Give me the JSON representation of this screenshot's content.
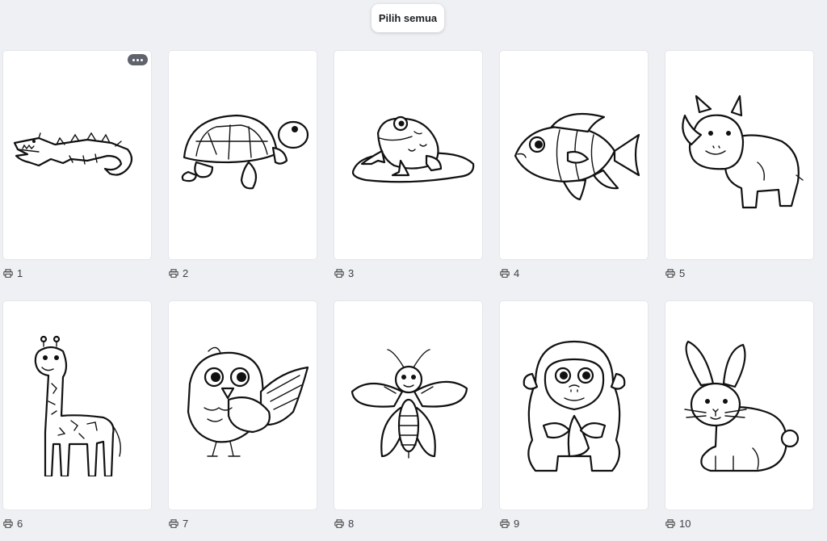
{
  "toolbar": {
    "select_all_label": "Pilih semua"
  },
  "pages": [
    {
      "number": "1",
      "illustration": "crocodile"
    },
    {
      "number": "2",
      "illustration": "turtle"
    },
    {
      "number": "3",
      "illustration": "frog"
    },
    {
      "number": "4",
      "illustration": "fish"
    },
    {
      "number": "5",
      "illustration": "rhino"
    },
    {
      "number": "6",
      "illustration": "giraffe"
    },
    {
      "number": "7",
      "illustration": "bird"
    },
    {
      "number": "8",
      "illustration": "bee"
    },
    {
      "number": "9",
      "illustration": "gorilla"
    },
    {
      "number": "10",
      "illustration": "rabbit"
    }
  ],
  "icons": {
    "page_icon": "printer-icon",
    "menu_icon": "more-options-icon"
  },
  "colors": {
    "background": "#eef0f4",
    "card": "#ffffff",
    "menu_pill": "#5f636b"
  }
}
